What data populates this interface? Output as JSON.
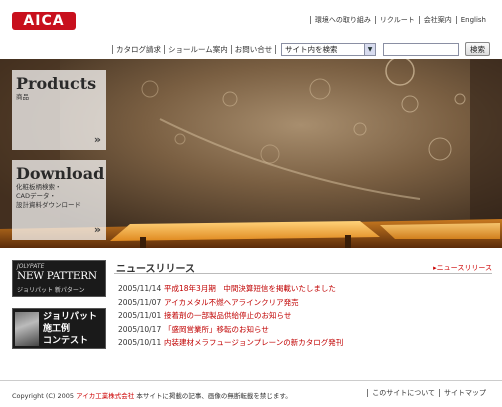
{
  "brand": {
    "logo_text": "AICA",
    "accent_color": "#c8101d"
  },
  "util_nav": [
    "環境への取り組み",
    "リクルート",
    "会社案内",
    "English"
  ],
  "toolbar": {
    "links": [
      "カタログ請求",
      "ショールーム案内",
      "お問い合せ"
    ],
    "site_select": "サイト内を検索",
    "search_button": "検索"
  },
  "hero": {
    "products": {
      "title": "Products",
      "subtitle": "商品",
      "chevron": "»"
    },
    "download": {
      "title": "Download",
      "subtitle_lines": [
        "化粧板柄検索・",
        "CADデータ・",
        "設計資料ダウンロード"
      ],
      "chevron": "»"
    }
  },
  "banners": {
    "jolypate": {
      "small": "JOLYPATE",
      "big": "NEW PATTERN",
      "line": "ジョリパット 新パターン"
    },
    "contest": {
      "lines": [
        "ジョリパット",
        "施工例",
        "コンテスト"
      ]
    }
  },
  "news": {
    "title": "ニュースリリース",
    "more_link": "▸ニュースリリース",
    "items": [
      {
        "date": "2005/11/14",
        "text": "平成18年3月期　中間決算短信を掲載いたしました"
      },
      {
        "date": "2005/11/07",
        "text": "アイカメタル不燃ヘアラインクリア発売"
      },
      {
        "date": "2005/11/01",
        "text": "接着剤の一部製品供給停止のお知らせ"
      },
      {
        "date": "2005/10/17",
        "text": "「盛岡営業所」移転のお知らせ"
      },
      {
        "date": "2005/10/11",
        "text": "内装建材メラフュージョンプレーンの新カタログ発刊"
      }
    ]
  },
  "footer": {
    "copyright_prefix": "Copyright (C) 2005 ",
    "company": "アイカ工業株式会社",
    "copyright_suffix": " 本サイトに掲載の記事、画像の無断転載を禁じます。",
    "links": [
      "このサイトについて",
      "サイトマップ"
    ]
  }
}
